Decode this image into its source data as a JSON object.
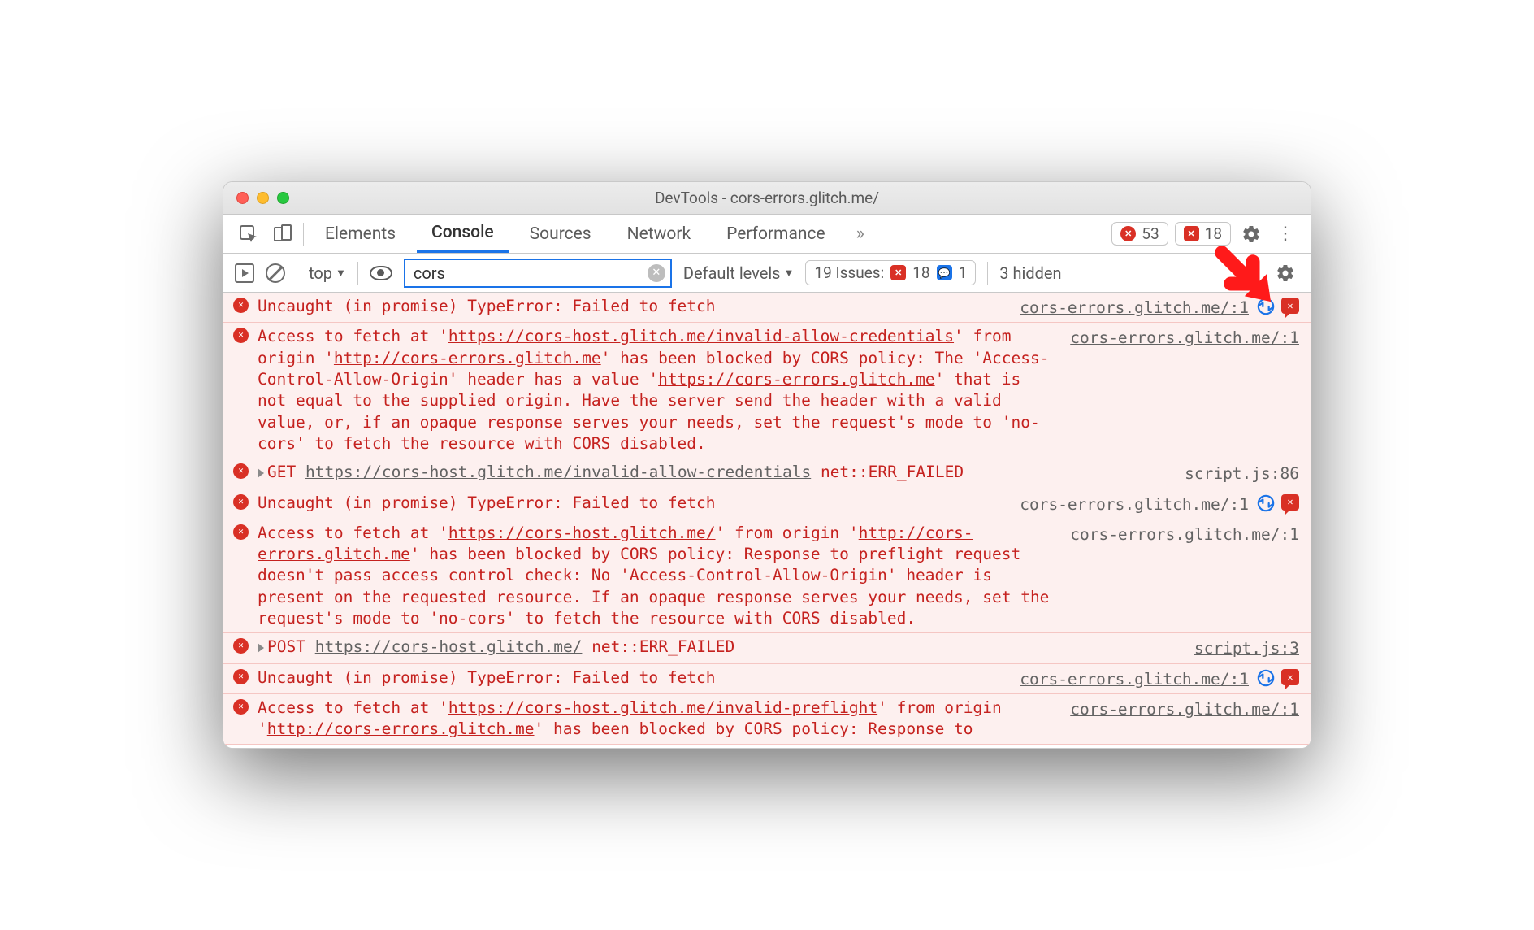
{
  "window": {
    "title": "DevTools - cors-errors.glitch.me/"
  },
  "tabs": {
    "items": [
      "Elements",
      "Console",
      "Sources",
      "Network",
      "Performance"
    ],
    "active": "Console",
    "overflow_glyph": "»"
  },
  "badges": {
    "errors": "53",
    "issues_err": "18"
  },
  "filter": {
    "context": "top",
    "dropdown_glyph": "▼",
    "input_value": "cors",
    "levels_label": "Default levels",
    "issues_label": "19 Issues:",
    "issues_err_count": "18",
    "issues_info_count": "1",
    "hidden_label": "3 hidden"
  },
  "messages": [
    {
      "type": "uncaught",
      "text": "Uncaught (in promise) TypeError: Failed to fetch",
      "source": "cors-errors.glitch.me/:1",
      "has_action_icons": true
    },
    {
      "type": "cors",
      "pre": "Access to fetch at '",
      "url1": "https://cors-host.glitch.me/invalid-allow-credentials",
      "mid1": "' from origin '",
      "url2": "http://cors-errors.glitch.me",
      "mid2": "' has been blocked by CORS policy: The 'Access-Control-Allow-Origin' header has a value '",
      "url3": "https://cors-errors.glitch.me",
      "tail": "' that is not equal to the supplied origin. Have the server send the header with a valid value, or, if an opaque response serves your needs, set the request's mode to 'no-cors' to fetch the resource with CORS disabled.",
      "source": "cors-errors.glitch.me/:1"
    },
    {
      "type": "net",
      "method": "GET",
      "url": "https://cors-host.glitch.me/invalid-allow-credentials",
      "err": "net::ERR_FAILED",
      "source": "script.js:86"
    },
    {
      "type": "uncaught",
      "text": "Uncaught (in promise) TypeError: Failed to fetch",
      "source": "cors-errors.glitch.me/:1",
      "has_action_icons": true
    },
    {
      "type": "cors",
      "pre": "Access to fetch at '",
      "url1": "https://cors-host.glitch.me/",
      "mid1": "' from origin '",
      "url2": "http://cors-errors.glitch.me",
      "mid2": "' has been blocked by CORS policy: Response to preflight request doesn't pass access control check: No 'Access-Control-Allow-Origin' header is present on the requested resource. If an opaque response serves your needs, set the request's mode to 'no-cors' to fetch the resource with CORS disabled.",
      "url3": "",
      "tail": "",
      "source": "cors-errors.glitch.me/:1"
    },
    {
      "type": "net",
      "method": "POST",
      "url": "https://cors-host.glitch.me/",
      "err": "net::ERR_FAILED",
      "source": "script.js:3"
    },
    {
      "type": "uncaught",
      "text": "Uncaught (in promise) TypeError: Failed to fetch",
      "source": "cors-errors.glitch.me/:1",
      "has_action_icons": true
    },
    {
      "type": "cors",
      "pre": "Access to fetch at '",
      "url1": "https://cors-host.glitch.me/invalid-preflight",
      "mid1": "' from origin '",
      "url2": "http://cors-errors.glitch.me",
      "mid2": "' has been blocked by CORS policy: Response to ",
      "url3": "",
      "tail": "",
      "source": "cors-errors.glitch.me/:1"
    }
  ]
}
